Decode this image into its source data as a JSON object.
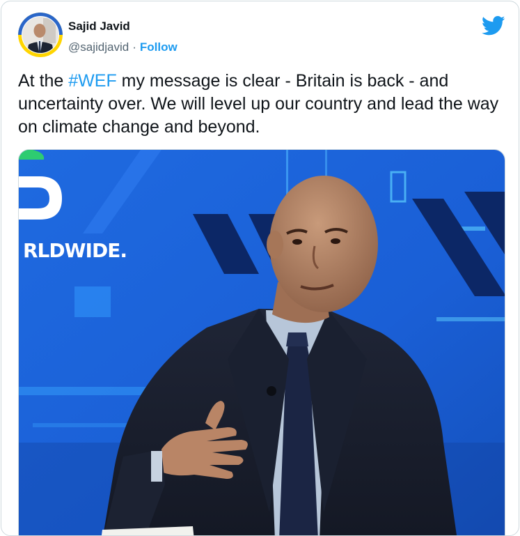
{
  "author": {
    "name": "Sajid Javid",
    "handle": "@sajidjavid",
    "separator": "·",
    "follow_label": "Follow"
  },
  "platform_icon": "twitter-bird-icon",
  "tweet": {
    "text_before": "At the ",
    "hashtag": "#WEF",
    "text_after": " my message is clear - Britain is back - and uncertainty over. We will level up our country and lead the way on climate change and beyond."
  },
  "media": {
    "backdrop_text": "RLDWIDE."
  },
  "colors": {
    "accent": "#1d9bf0",
    "text": "#0f1419",
    "muted": "#536471",
    "backdrop_blue": "#1a5fd6",
    "avatar_ring_blue": "#2a66c9",
    "avatar_ring_yellow": "#ffd500"
  }
}
